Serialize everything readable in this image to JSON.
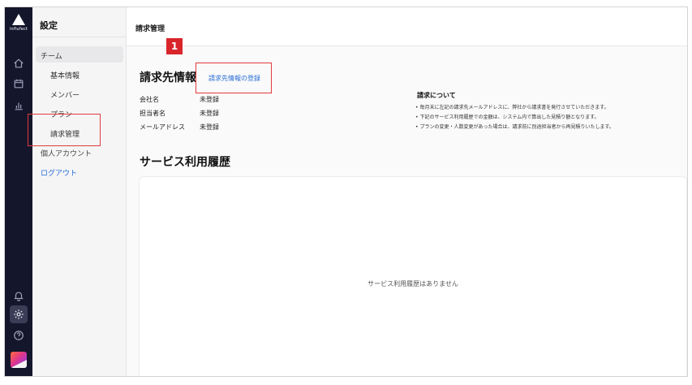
{
  "rail": {
    "logo_text": "influfect",
    "icons": [
      "home-icon",
      "calendar-icon",
      "bar-chart-icon",
      "bell-icon",
      "gear-icon",
      "help-icon"
    ]
  },
  "settings": {
    "title": "設定",
    "group_label": "チーム",
    "items": [
      {
        "label": "基本情報"
      },
      {
        "label": "メンバー"
      },
      {
        "label": "プラン"
      },
      {
        "label": "請求管理"
      }
    ],
    "personal_account": "個人アカウント",
    "logout": "ログアウト"
  },
  "header": {
    "title": "請求管理"
  },
  "billing": {
    "title": "請求先情報",
    "register_link": "請求先情報の登録",
    "fields": [
      {
        "label": "会社名",
        "value": "未登録"
      },
      {
        "label": "担当者名",
        "value": "未登録"
      },
      {
        "label": "メールアドレス",
        "value": "未登録"
      }
    ]
  },
  "about": {
    "title": "請求について",
    "bullets": [
      "• 毎月末に左記の請求先メールアドレスに、弊社から請求書を発行させていただきます。",
      "• 下記のサービス利用履歴での金額は、システム内で算出した見積り額となります。",
      "• プランの変更・人数変更があった場合は、請求前に別途担当者から再見積りいたします。"
    ]
  },
  "history": {
    "title": "サービス利用履歴",
    "empty_message": "サービス利用履歴はありません"
  },
  "annotations": {
    "badge": "1",
    "color": "#d9262b"
  }
}
